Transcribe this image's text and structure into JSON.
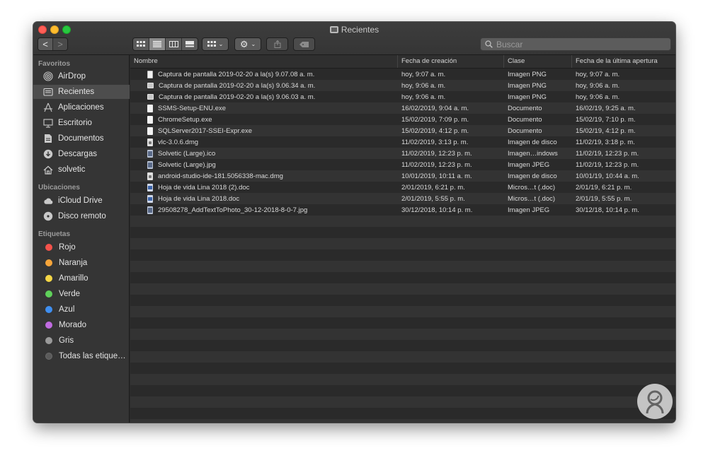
{
  "window": {
    "title": "Recientes"
  },
  "toolbar": {
    "back": "<",
    "forward": ">",
    "views": [
      "icon-view",
      "list-view",
      "column-view",
      "gallery-view"
    ],
    "search_placeholder": "Buscar"
  },
  "sidebar": {
    "favoritos_label": "Favoritos",
    "favoritos": [
      {
        "label": "AirDrop",
        "icon": "airdrop-icon"
      },
      {
        "label": "Recientes",
        "icon": "recents-icon",
        "selected": true
      },
      {
        "label": "Aplicaciones",
        "icon": "applications-icon"
      },
      {
        "label": "Escritorio",
        "icon": "desktop-icon"
      },
      {
        "label": "Documentos",
        "icon": "documents-icon"
      },
      {
        "label": "Descargas",
        "icon": "downloads-icon"
      },
      {
        "label": "solvetic",
        "icon": "home-icon"
      }
    ],
    "ubicaciones_label": "Ubicaciones",
    "ubicaciones": [
      {
        "label": "iCloud Drive",
        "icon": "icloud-icon"
      },
      {
        "label": "Disco remoto",
        "icon": "remote-disc-icon"
      }
    ],
    "etiquetas_label": "Etiquetas",
    "etiquetas": [
      {
        "label": "Rojo",
        "color": "#f4524b"
      },
      {
        "label": "Naranja",
        "color": "#f7a53a"
      },
      {
        "label": "Amarillo",
        "color": "#f6d746"
      },
      {
        "label": "Verde",
        "color": "#5fd15a"
      },
      {
        "label": "Azul",
        "color": "#3f8ff0"
      },
      {
        "label": "Morado",
        "color": "#c06be0"
      },
      {
        "label": "Gris",
        "color": "#9a9a9a"
      },
      {
        "label": "Todas las etique…",
        "color": ""
      }
    ]
  },
  "table": {
    "columns": [
      "Nombre",
      "Fecha de creación",
      "Clase",
      "Fecha de la última apertura"
    ],
    "rows": [
      {
        "name": "Captura de pantalla 2019-02-20 a la(s) 9.07.08 a. m.",
        "created": "hoy, 9:07 a. m.",
        "kind": "Imagen PNG",
        "opened": "hoy, 9:07 a. m.",
        "icon": "shot"
      },
      {
        "name": "Captura de pantalla 2019-02-20 a la(s) 9.06.34 a. m.",
        "created": "hoy, 9:06 a. m.",
        "kind": "Imagen PNG",
        "opened": "hoy, 9:06 a. m.",
        "icon": "img"
      },
      {
        "name": "Captura de pantalla 2019-02-20 a la(s) 9.06.03 a. m.",
        "created": "hoy, 9:06 a. m.",
        "kind": "Imagen PNG",
        "opened": "hoy, 9:06 a. m.",
        "icon": "img"
      },
      {
        "name": "SSMS-Setup-ENU.exe",
        "created": "16/02/2019, 9:04 a. m.",
        "kind": "Documento",
        "opened": "16/02/19, 9:25 a. m.",
        "icon": "file"
      },
      {
        "name": "ChromeSetup.exe",
        "created": "15/02/2019, 7:09 p. m.",
        "kind": "Documento",
        "opened": "15/02/19, 7:10 p. m.",
        "icon": "file"
      },
      {
        "name": "SQLServer2017-SSEI-Expr.exe",
        "created": "15/02/2019, 4:12 p. m.",
        "kind": "Documento",
        "opened": "15/02/19, 4:12 p. m.",
        "icon": "file"
      },
      {
        "name": "vlc-3.0.6.dmg",
        "created": "11/02/2019, 3:13 p. m.",
        "kind": "Imagen de disco",
        "opened": "11/02/19, 3:18 p. m.",
        "icon": "dmg"
      },
      {
        "name": "Solvetic (Large).ico",
        "created": "11/02/2019, 12:23 p. m.",
        "kind": "Imagen…indows",
        "opened": "11/02/19, 12:23 p. m.",
        "icon": "jpg"
      },
      {
        "name": "Solvetic (Large).jpg",
        "created": "11/02/2019, 12:23 p. m.",
        "kind": "Imagen JPEG",
        "opened": "11/02/19, 12:23 p. m.",
        "icon": "jpg"
      },
      {
        "name": "android-studio-ide-181.5056338-mac.dmg",
        "created": "10/01/2019, 10:11 a. m.",
        "kind": "Imagen de disco",
        "opened": "10/01/19, 10:44 a. m.",
        "icon": "dmg"
      },
      {
        "name": "Hoja de vida Lina 2018 (2).doc",
        "created": "2/01/2019, 6:21 p. m.",
        "kind": "Micros…t (.doc)",
        "opened": "2/01/19, 6:21 p. m.",
        "icon": "doc"
      },
      {
        "name": "Hoja de vida Lina 2018.doc",
        "created": "2/01/2019, 5:55 p. m.",
        "kind": "Micros…t (.doc)",
        "opened": "2/01/19, 5:55 p. m.",
        "icon": "doc"
      },
      {
        "name": "29508278_AddTextToPhoto_30-12-2018-8-0-7.jpg",
        "created": "30/12/2018, 10:14 p. m.",
        "kind": "Imagen JPEG",
        "opened": "30/12/18, 10:14 p. m.",
        "icon": "jpg"
      }
    ]
  }
}
